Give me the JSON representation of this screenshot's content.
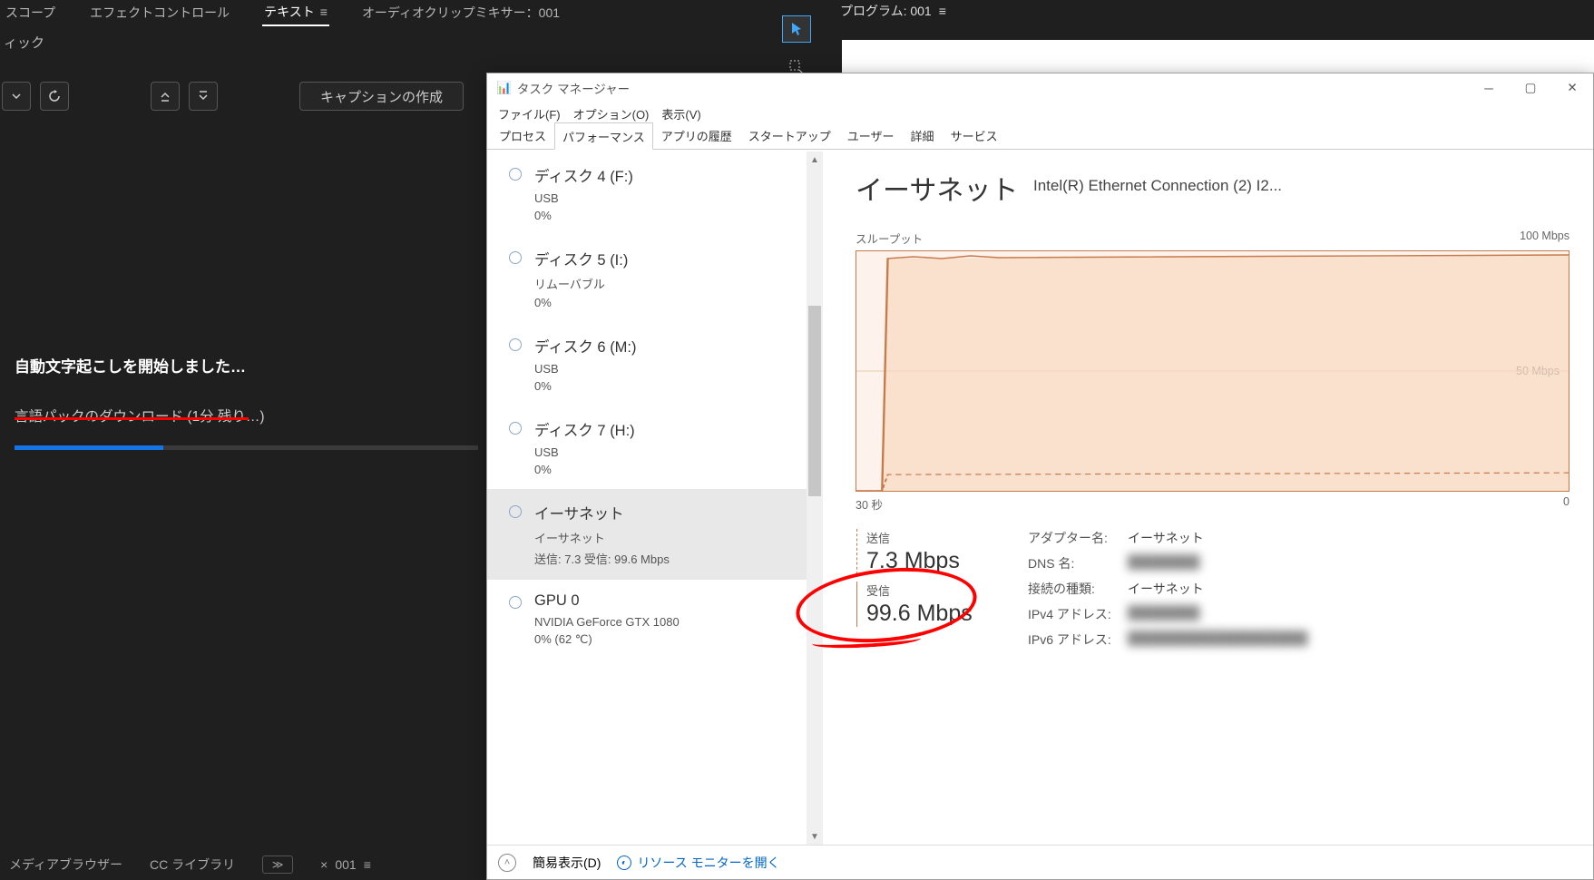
{
  "editor": {
    "tabs": [
      "スコープ",
      "エフェクトコントロール",
      "テキスト",
      "オーディオクリップミキサー：001"
    ],
    "active_tab_index": 2,
    "sub_tab": "ィック",
    "buttons": {
      "caption_create": "キャプションの作成"
    },
    "transcribe": {
      "title": "自動文字起こしを開始しました…",
      "subtitle": "言語パックのダウンロード (1分 残り…)",
      "progress_percent": 32
    },
    "bottom_tabs": {
      "media_browser": "メディアブラウザー",
      "cc_library": "CC ライブラリ",
      "sequence_name": "001"
    },
    "program_panel": "プログラム: 001"
  },
  "task_manager": {
    "title": "タスク マネージャー",
    "menu": {
      "file": "ファイル(F)",
      "options": "オプション(O)",
      "view": "表示(V)"
    },
    "tabs": [
      "プロセス",
      "パフォーマンス",
      "アプリの履歴",
      "スタートアップ",
      "ユーザー",
      "詳細",
      "サービス"
    ],
    "active_tab_index": 1,
    "sidebar": [
      {
        "name": "ディスク 4 (F:)",
        "sub": "USB",
        "val": "0%"
      },
      {
        "name": "ディスク 5 (I:)",
        "sub": "リムーバブル",
        "val": "0%"
      },
      {
        "name": "ディスク 6 (M:)",
        "sub": "USB",
        "val": "0%"
      },
      {
        "name": "ディスク 7 (H:)",
        "sub": "USB",
        "val": "0%"
      },
      {
        "name": "イーサネット",
        "sub": "イーサネット",
        "val": "送信: 7.3 受信: 99.6 Mbps",
        "selected": true
      },
      {
        "name": "GPU 0",
        "sub": "NVIDIA GeForce GTX 1080",
        "val": "0%  (62 ℃)"
      }
    ],
    "main": {
      "heading": "イーサネット",
      "adapter_full": "Intel(R) Ethernet Connection (2) I2...",
      "chart_label_tl": "スループット",
      "chart_label_tr": "100 Mbps",
      "chart_label_mid": "50 Mbps",
      "chart_label_bl": "30 秒",
      "chart_label_br": "0",
      "send_label": "送信",
      "send_value": "7.3 Mbps",
      "recv_label": "受信",
      "recv_value": "99.6 Mbps",
      "props": [
        {
          "k": "アダプター名:",
          "v": "イーサネット"
        },
        {
          "k": "DNS 名:",
          "v": "████████",
          "blur": true
        },
        {
          "k": "接続の種類:",
          "v": "イーサネット"
        },
        {
          "k": "IPv4 アドレス:",
          "v": "████████",
          "blur": true
        },
        {
          "k": "IPv6 アドレス:",
          "v": "████████████████████",
          "blur": true
        }
      ]
    },
    "footer": {
      "fewer": "簡易表示(D)",
      "resmon": "リソース モニターを開く"
    }
  },
  "chart_data": {
    "type": "line",
    "title": "スループット",
    "xlabel": "seconds",
    "ylabel": "Mbps",
    "xlim": [
      30,
      0
    ],
    "ylim": [
      0,
      100
    ],
    "series": [
      {
        "name": "受信",
        "values": [
          0,
          0,
          98,
          99,
          98,
          99,
          99,
          98,
          99,
          99,
          98,
          99,
          99,
          98,
          99,
          99,
          99,
          98,
          99,
          99,
          98,
          99,
          99,
          98,
          99,
          99,
          98,
          99,
          99,
          99
        ]
      },
      {
        "name": "送信",
        "values": [
          0,
          0,
          6,
          7,
          8,
          7,
          7,
          8,
          7,
          7,
          6,
          7,
          8,
          7,
          7,
          7,
          6,
          7,
          8,
          7,
          7,
          8,
          7,
          7,
          6,
          7,
          8,
          7,
          7,
          7
        ]
      }
    ]
  }
}
